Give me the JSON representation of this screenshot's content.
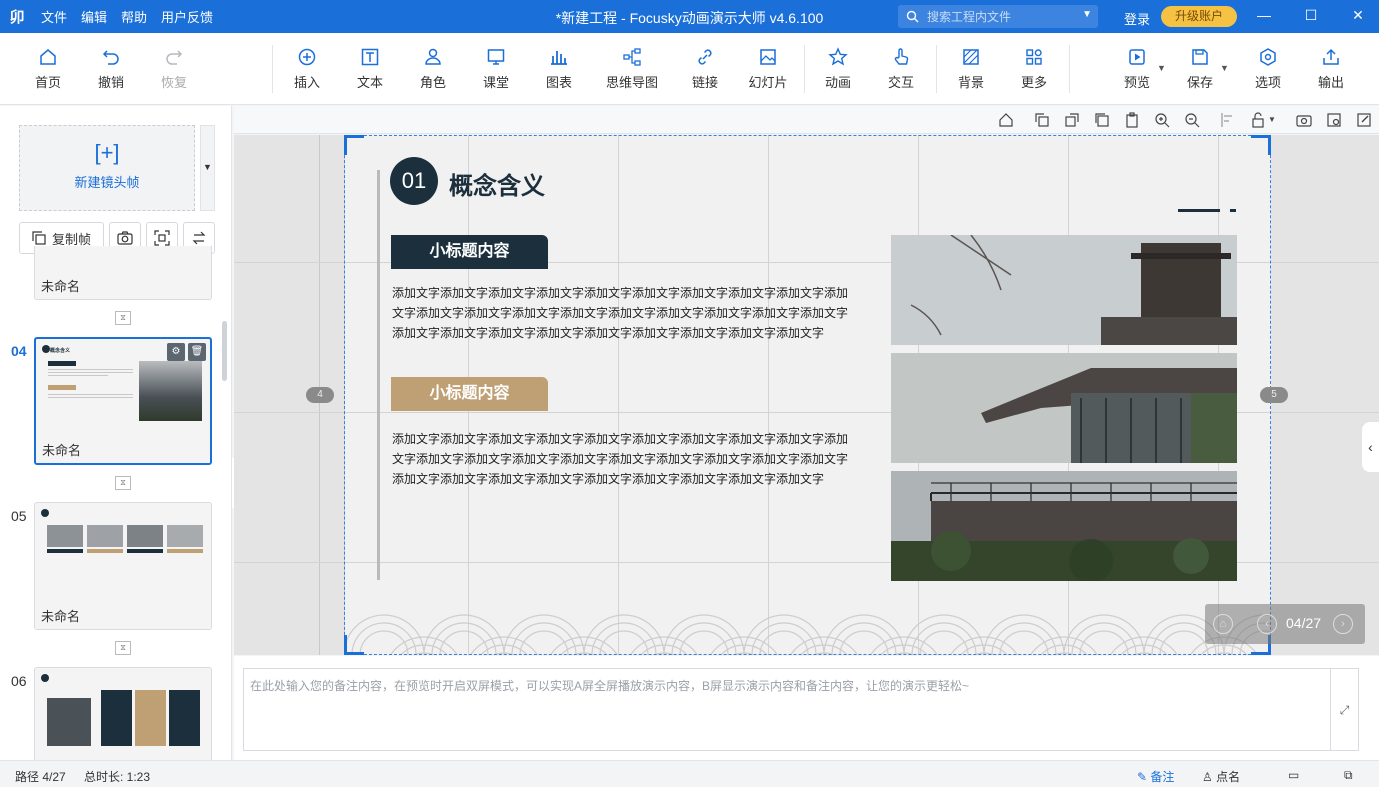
{
  "titlebar": {
    "logo": "卯",
    "menus": [
      "文件",
      "编辑",
      "帮助",
      "用户反馈"
    ],
    "window_title": "*新建工程 - Focusky动画演示大师  v4.6.100",
    "search_placeholder": "搜索工程内文件",
    "login": "登录",
    "upgrade": "升级账户"
  },
  "toolbar": {
    "home": "首页",
    "undo": "撤销",
    "redo": "恢复",
    "insert": "插入",
    "text": "文本",
    "role": "角色",
    "class": "课堂",
    "chart": "图表",
    "mindmap": "思维导图",
    "link": "链接",
    "slide": "幻灯片",
    "animation": "动画",
    "interact": "交互",
    "background": "背景",
    "more": "更多",
    "preview": "预览",
    "save": "保存",
    "options": "选项",
    "export": "输出"
  },
  "left": {
    "new_frame": "新建镜头帧",
    "copy_frame": "复制帧",
    "frames": [
      {
        "num": "",
        "name": "未命名"
      },
      {
        "num": "04",
        "name": "未命名"
      },
      {
        "num": "05",
        "name": "未命名"
      },
      {
        "num": "06",
        "name": ""
      }
    ]
  },
  "slide": {
    "number": "01",
    "title": "概念含义",
    "subhead1": "小标题内容",
    "subhead2": "小标题内容",
    "body1": "添加文字添加文字添加文字添加文字添加文字添加文字添加文字添加文字添加文字添加文字添加文字添加文字添加文字添加文字添加文字添加文字添加文字添加文字添加文字添加文字添加文字添加文字添加文字添加文字添加文字添加文字添加文字添加文字",
    "body2": "添加文字添加文字添加文字添加文字添加文字添加文字添加文字添加文字添加文字添加文字添加文字添加文字添加文字添加文字添加文字添加文字添加文字添加文字添加文字添加文字添加文字添加文字添加文字添加文字添加文字添加文字添加文字添加文字",
    "prev_page": "4",
    "next_page": "5",
    "counter": "04/27"
  },
  "notes": {
    "placeholder": "在此处输入您的备注内容，在预览时开启双屏模式，可以实现A屏全屏播放演示内容，B屏显示演示内容和备注内容，让您的演示更轻松~"
  },
  "status": {
    "path": "路径 4/27",
    "duration": "总时长: 1:23",
    "notes": "备注",
    "rollcall": "点名"
  },
  "colors": {
    "accent": "#1a6fd8",
    "slide_dark": "#1c2f3d",
    "slide_tan": "#bf9f74",
    "upgrade": "#f5c244"
  }
}
